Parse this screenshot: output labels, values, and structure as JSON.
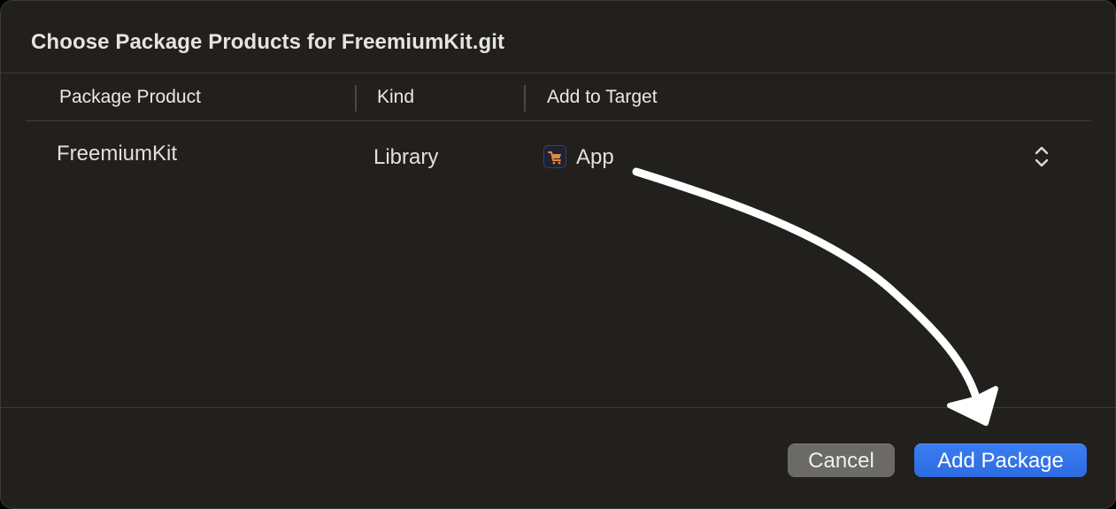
{
  "dialog": {
    "title": "Choose Package Products for FreemiumKit.git"
  },
  "table": {
    "columns": [
      "Package Product",
      "Kind",
      "Add to Target"
    ],
    "rows": [
      {
        "product": "FreemiumKit",
        "kind": "Library",
        "target": "App",
        "target_icon": "app-target-icon"
      }
    ]
  },
  "buttons": {
    "cancel_label": "Cancel",
    "add_label": "Add Package"
  },
  "colors": {
    "background": "#22201d",
    "accent": "#2f6fe4",
    "cancel_button": "#6b6a68",
    "annotation_arrow": "#ffffff"
  },
  "annotation": {
    "icon": "hand-drawn-arrow-icon",
    "points_to": "Add Package"
  }
}
